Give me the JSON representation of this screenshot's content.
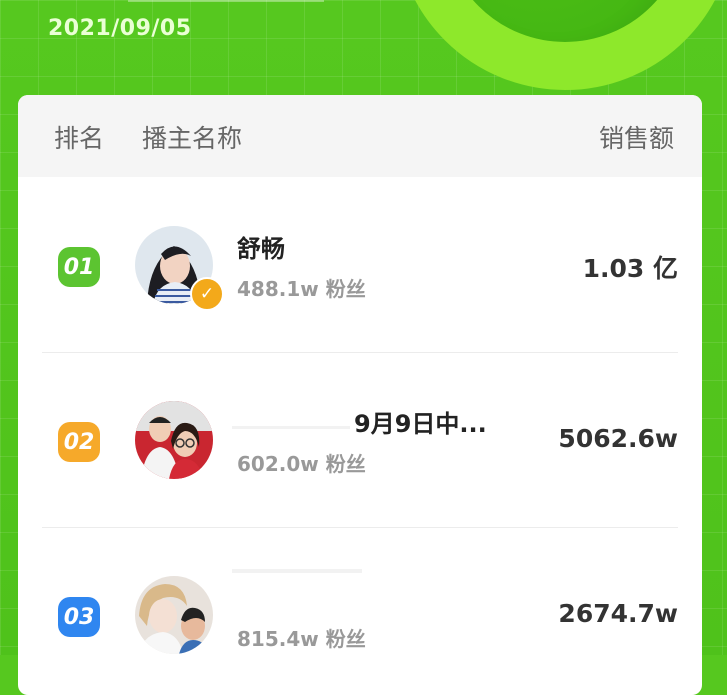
{
  "header": {
    "date": "2021/09/05"
  },
  "table": {
    "columns": {
      "rank": "排名",
      "name": "播主名称",
      "sales": "销售额"
    },
    "rows": [
      {
        "rank": "01",
        "name": "舒畅",
        "fans": "488.1w 粉丝",
        "sales": "1.03 亿",
        "rank_color": "#5cc431",
        "verified": true
      },
      {
        "rank": "02",
        "name": "9月9日中...",
        "fans": "602.0w 粉丝",
        "sales": "5062.6w",
        "rank_color": "#f6a92a",
        "verified": false
      },
      {
        "rank": "03",
        "name": "",
        "fans": "815.4w 粉丝",
        "sales": "2674.7w",
        "rank_color": "#2f86f0",
        "verified": false
      }
    ]
  },
  "colors": {
    "background": "#54c51e",
    "accent_ring": "#8ee82b",
    "card": "#ffffff"
  }
}
